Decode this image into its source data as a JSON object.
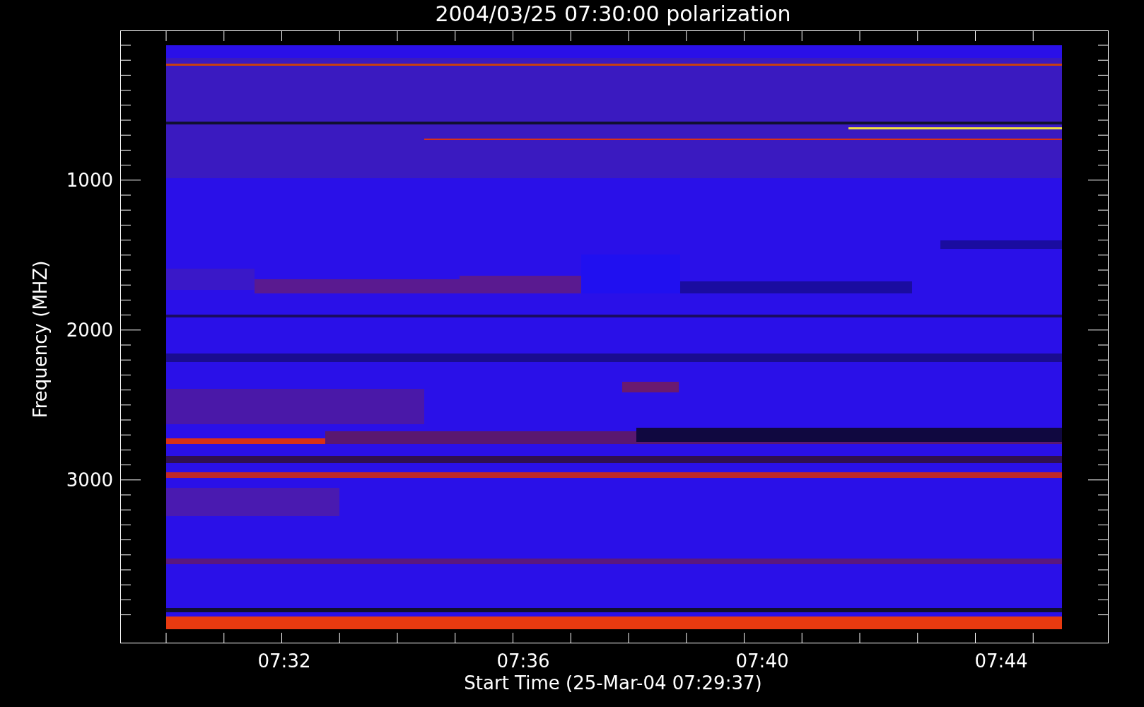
{
  "plot": {
    "title": "2004/03/25 07:30:00 polarization",
    "y_axis": {
      "label": "Frequency (MHZ)",
      "ticks": [
        "1000",
        "2000",
        "3000"
      ]
    },
    "x_axis": {
      "label": "Start Time (25-Mar-04 07:29:37)",
      "ticks": [
        "07:32",
        "07:36",
        "07:40",
        "07:44"
      ]
    }
  }
}
